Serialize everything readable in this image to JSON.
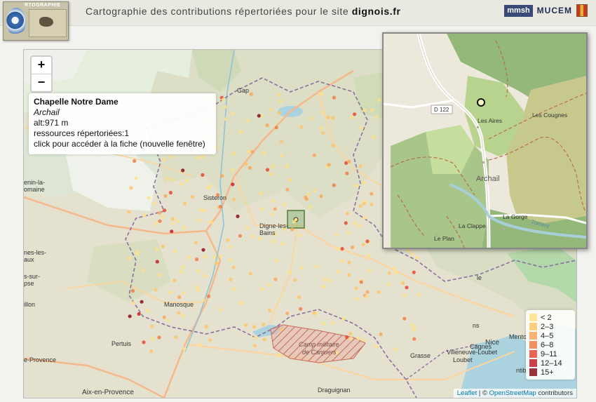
{
  "header": {
    "title_prefix": "Cartographie des contributions répertoriées pour le site",
    "site_name": "dignois.fr",
    "logo_label": "RTOGRAPHIE",
    "partner_mmsh": "mmsh",
    "partner_mucem": "MUCEM"
  },
  "map": {
    "zoom_in": "+",
    "zoom_out": "−",
    "labels": {
      "gap": "Gap",
      "sisteron": "Sisteron",
      "digne": "Digne-les-Bains",
      "manosque": "Manosque",
      "pertuis": "Pertuis",
      "aix": "Aix-en-Provence",
      "draguignan": "Draguignan",
      "grasse": "Grasse",
      "nice": "Nice",
      "villeneuve": "Villeneuve-Loubet",
      "loubet": "Loubet",
      "cagnes": "Cagnes",
      "camp1": "Camp militaire",
      "camp2": "de Canjuers",
      "mentone": "Mento",
      "left1": "enin-la-",
      "left2": "omaine",
      "left3": "nes-les-",
      "left4": "aux",
      "left5": "s-sur-",
      "left6": "pse",
      "left7": "illon",
      "left8": "e-Provence",
      "right1": "le",
      "right2": "ns",
      "right3": "ntibes"
    },
    "popup": {
      "name": "Chapelle Notre Dame",
      "commune": "Archail",
      "altitude": "alt:971 m",
      "resources": "ressources répertoriées:1",
      "link": "click pour accéder à la fiche (nouvelle fenêtre)"
    },
    "legend": [
      {
        "label": "< 2",
        "color": "#fde08a"
      },
      {
        "label": "2–3",
        "color": "#fec46a"
      },
      {
        "label": "4–5",
        "color": "#f9a65a"
      },
      {
        "label": "6–8",
        "color": "#f17d45"
      },
      {
        "label": "9–11",
        "color": "#e54a37"
      },
      {
        "label": "12–14",
        "color": "#c8202a"
      },
      {
        "label": "15+",
        "color": "#8a0f1b"
      }
    ],
    "attribution_leaflet": "Leaflet",
    "attribution_sep": " | © ",
    "attribution_osm": "OpenStreetMap",
    "attribution_suffix": " contributors"
  },
  "minimap": {
    "road": "D 122",
    "places": {
      "aires": "Les Aires",
      "cougnes": "Les Cougnes",
      "archail": "Archail",
      "clappe": "La Clappe",
      "gorge": "La Gorge",
      "plan": "Le Plan",
      "torrent": "Torrent"
    }
  }
}
